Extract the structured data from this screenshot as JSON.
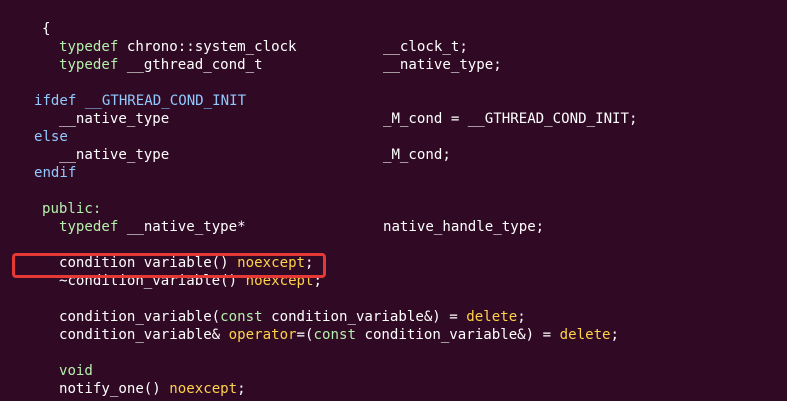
{
  "colors": {
    "background": "#300a24",
    "text": "#ffffff",
    "keyword": "#b4f0ab",
    "preprocessor": "#91c9ff",
    "specifier": "#ffd24a",
    "highlight_box": "#e53935"
  },
  "code": {
    "l01": {
      "a": "{"
    },
    "l02": {
      "kw": "typedef",
      "a": " chrono::system_clock",
      "b": "__clock_t;"
    },
    "l03": {
      "kw": "typedef",
      "a": " __gthread_cond_t",
      "b": "__native_type;"
    },
    "l04": {
      "pp": "ifdef",
      "ppname": " __GTHREAD_COND_INIT"
    },
    "l05": {
      "a": "__native_type",
      "b": "_M_cond = __GTHREAD_COND_INIT;"
    },
    "l06": {
      "pp": "else"
    },
    "l07": {
      "a": "__native_type",
      "b": "_M_cond;"
    },
    "l08": {
      "pp": "endif"
    },
    "l09": {
      "kw": "public:"
    },
    "l10": {
      "kw": "typedef",
      "a": " __native_type*",
      "b": "native_handle_type;"
    },
    "l11": {
      "a": "condition variable() ",
      "spec": "noexcept",
      "c": ";"
    },
    "l12": {
      "a": "~condition_variable() ",
      "spec": "noexcept",
      "c": ";"
    },
    "l13": {
      "a": "condition_variable(",
      "kw": "const",
      "b": " condition_variable&) = ",
      "spec": "delete",
      "c": ";"
    },
    "l14": {
      "a": "condition_variable& ",
      "spec1": "operator",
      "b": "=(",
      "kw": "const",
      "c": " condition_variable&) = ",
      "spec2": "delete",
      "d": ";"
    },
    "l15": {
      "kw": "void"
    },
    "l16": {
      "a": "notify_one() ",
      "spec": "noexcept",
      "c": ";"
    }
  }
}
